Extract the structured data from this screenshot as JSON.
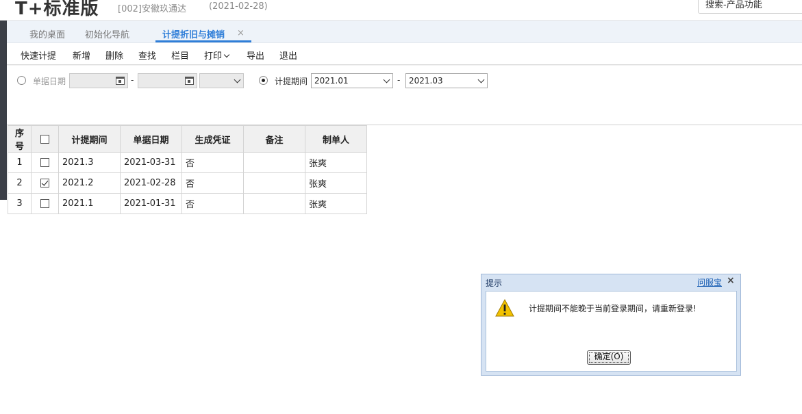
{
  "header": {
    "logo": "T+标准版",
    "company": "[002]安徽玖通达",
    "date": "(2021-02-28)",
    "search_text": "搜索-产品功能"
  },
  "tabs": [
    {
      "label": "我的桌面"
    },
    {
      "label": "初始化导航"
    },
    {
      "label": "计提折旧与摊销",
      "active": true
    }
  ],
  "tab_close": "×",
  "toolbar": {
    "items": [
      "快速计提",
      "新增",
      "删除",
      "查找",
      "栏目",
      "打印",
      "导出",
      "退出"
    ]
  },
  "filter": {
    "doc_date_label": "单据日期",
    "period_label": "计提期间",
    "period_from": "2021.01",
    "period_to": "2021.03",
    "dash": "-"
  },
  "table": {
    "columns": [
      "序号",
      "",
      "计提期间",
      "单据日期",
      "生成凭证",
      "备注",
      "制单人"
    ],
    "rows": [
      {
        "no": "1",
        "checked": false,
        "period": "2021.3",
        "date": "2021-03-31",
        "voucher": "否",
        "note": "",
        "maker": "张爽"
      },
      {
        "no": "2",
        "checked": true,
        "period": "2021.2",
        "date": "2021-02-28",
        "voucher": "否",
        "note": "",
        "maker": "张爽"
      },
      {
        "no": "3",
        "checked": false,
        "period": "2021.1",
        "date": "2021-01-31",
        "voucher": "否",
        "note": "",
        "maker": "张爽"
      }
    ]
  },
  "dialog": {
    "title": "提示",
    "help_link": "问服宝",
    "close": "×",
    "message": "计提期间不能晚于当前登录期间，请重新登录!",
    "ok_label": "确定(O)"
  },
  "colors": {
    "accent": "#2f7ed8",
    "dialog_frame": "#d6e3f3",
    "warning": "#f2c200"
  }
}
